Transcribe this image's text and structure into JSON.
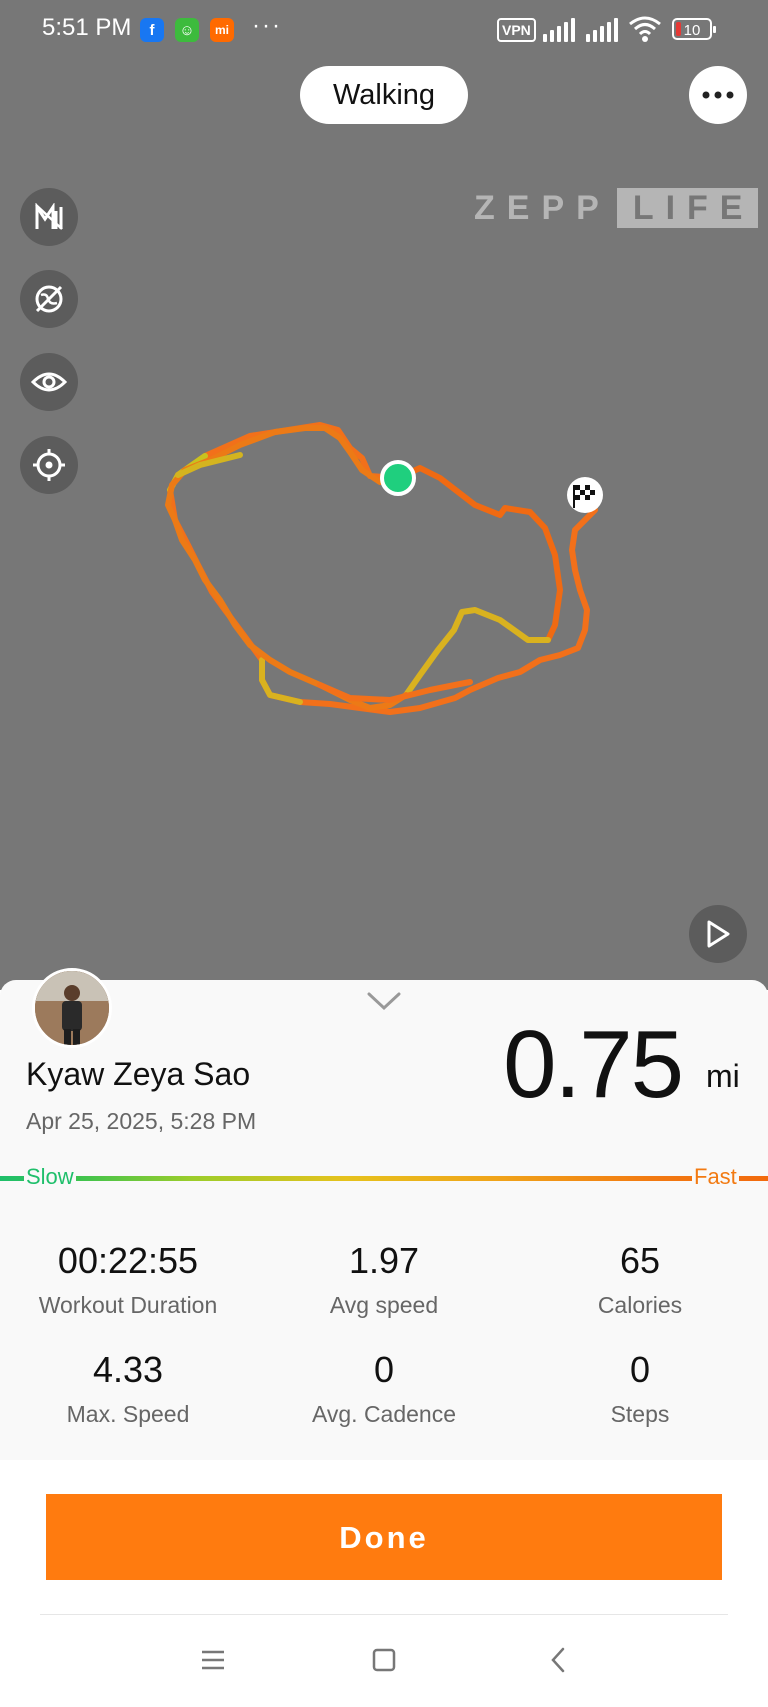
{
  "status_bar": {
    "time": "5:51 PM",
    "apps": [
      {
        "icon": "facebook-icon",
        "glyph": "f",
        "color": "#1877f2"
      },
      {
        "icon": "android-app-icon",
        "glyph": "☺",
        "color": "#3dbb3d"
      },
      {
        "icon": "mi-app-icon",
        "glyph": "mi",
        "color": "#ff6a00"
      }
    ],
    "more": "···",
    "vpn": "VPN",
    "battery": "10"
  },
  "header": {
    "activity_type": "Walking"
  },
  "map": {
    "brand_name": "ZEPP",
    "brand_suffix": "LIFE",
    "tools": [
      "speed-toggle-icon",
      "map-layer-off-icon",
      "visibility-eye-icon",
      "locate-target-icon"
    ],
    "route_colors": {
      "fast": "#f2701a",
      "medium": "#e3a020",
      "slow": "#c8c21f"
    },
    "start_marker_color": "#1fcf7e"
  },
  "summary": {
    "user_name": "Kyaw Zeya Sao",
    "date": "Apr 25, 2025, 5:28 PM",
    "distance": "0.75",
    "distance_unit": "mi",
    "speed_scale": {
      "slow": "Slow",
      "fast": "Fast"
    }
  },
  "stats": [
    {
      "value": "00:22:55",
      "label": "Workout Duration"
    },
    {
      "value": "1.97",
      "label": "Avg speed"
    },
    {
      "value": "65",
      "label": "Calories"
    },
    {
      "value": "4.33",
      "label": "Max. Speed"
    },
    {
      "value": "0",
      "label": "Avg. Cadence"
    },
    {
      "value": "0",
      "label": "Steps"
    }
  ],
  "actions": {
    "done": "Done"
  },
  "accent_color": "#ff7b0f"
}
